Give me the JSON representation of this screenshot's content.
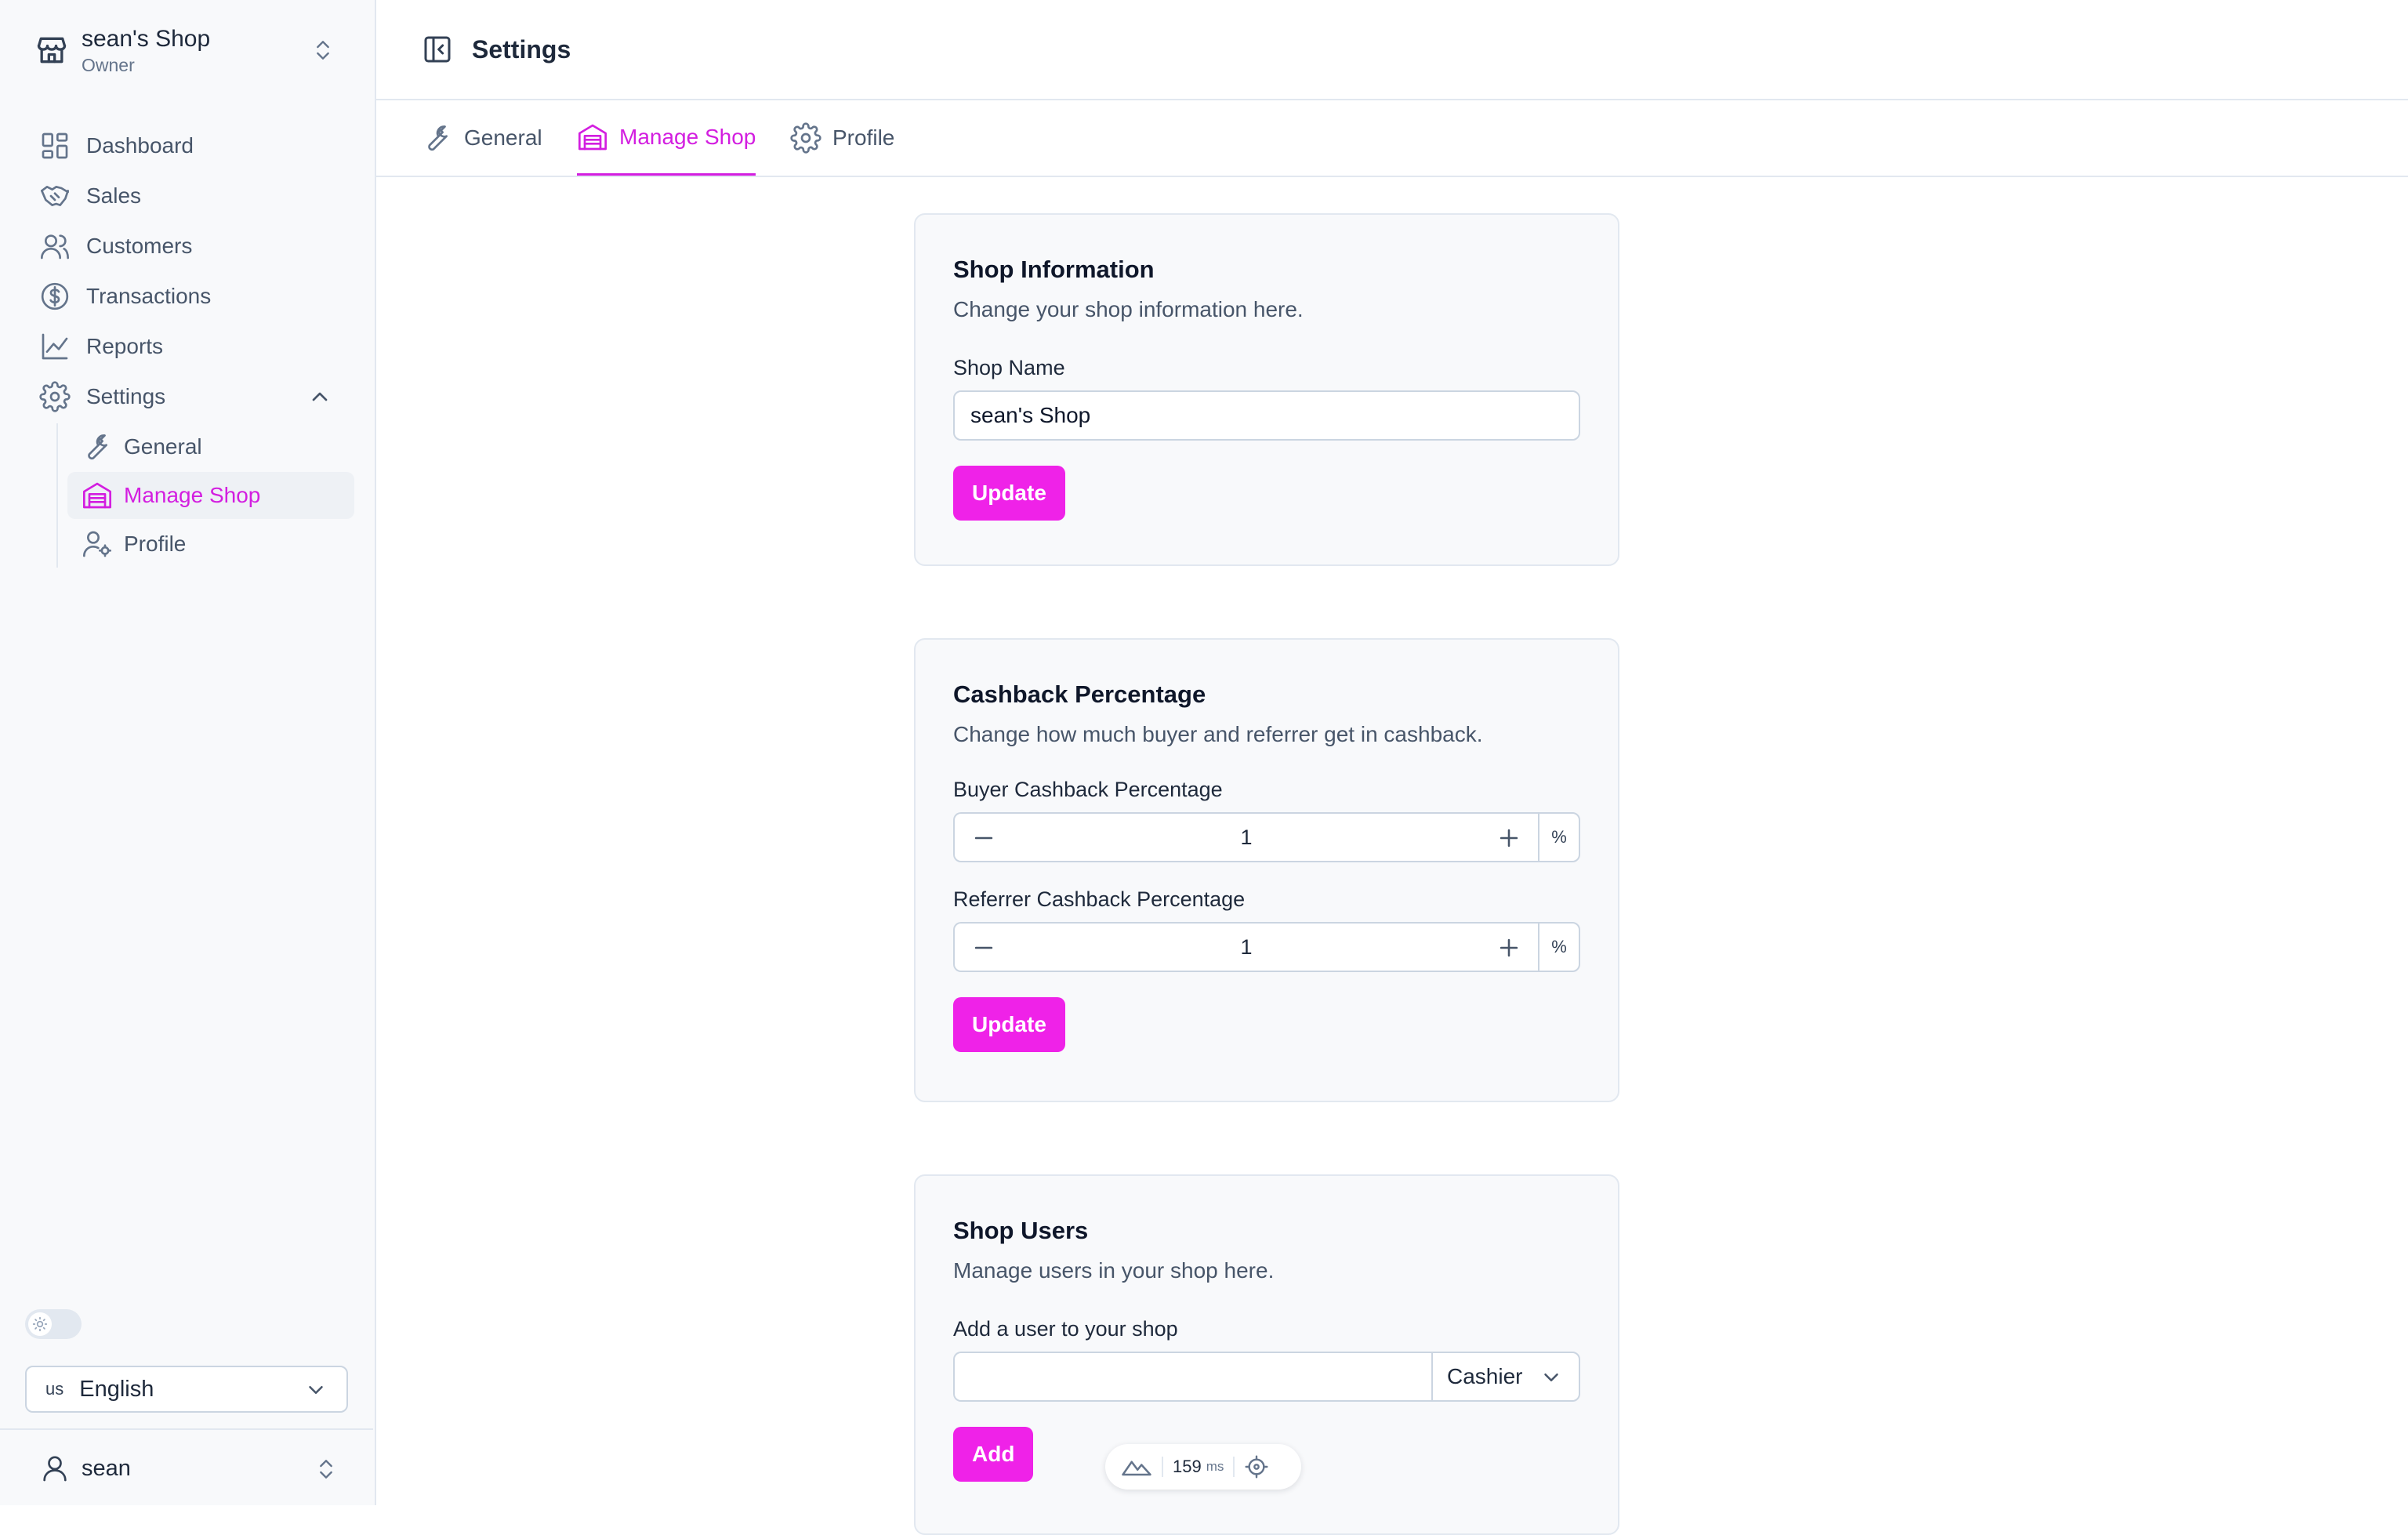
{
  "sidebar": {
    "shop_name": "sean's Shop",
    "shop_role": "Owner",
    "nav": [
      {
        "label": "Dashboard",
        "icon": "dashboard-icon"
      },
      {
        "label": "Sales",
        "icon": "handshake-icon"
      },
      {
        "label": "Customers",
        "icon": "users-icon"
      },
      {
        "label": "Transactions",
        "icon": "dollar-circle-icon"
      },
      {
        "label": "Reports",
        "icon": "line-chart-icon"
      },
      {
        "label": "Settings",
        "icon": "gear-icon"
      }
    ],
    "settings_sub": [
      {
        "label": "General",
        "icon": "wrench-icon"
      },
      {
        "label": "Manage Shop",
        "icon": "warehouse-icon",
        "active": true
      },
      {
        "label": "Profile",
        "icon": "user-cog-icon"
      }
    ],
    "language": {
      "code": "us",
      "name": "English"
    },
    "user_name": "sean"
  },
  "header": {
    "title": "Settings"
  },
  "tabs": [
    {
      "label": "General",
      "icon": "wrench-icon"
    },
    {
      "label": "Manage Shop",
      "icon": "warehouse-icon",
      "active": true
    },
    {
      "label": "Profile",
      "icon": "gear-icon"
    }
  ],
  "shop_info": {
    "title": "Shop Information",
    "description": "Change your shop information here.",
    "field_label": "Shop Name",
    "field_value": "sean's Shop",
    "button": "Update"
  },
  "cashback": {
    "title": "Cashback Percentage",
    "description": "Change how much buyer and referrer get in cashback.",
    "buyer_label": "Buyer Cashback Percentage",
    "buyer_value": "1",
    "referrer_label": "Referrer Cashback Percentage",
    "referrer_value": "1",
    "unit": "%",
    "button": "Update"
  },
  "shop_users": {
    "title": "Shop Users",
    "description": "Manage users in your shop here.",
    "field_label": "Add a user to your shop",
    "input_value": "",
    "role": "Cashier",
    "button": "Add"
  },
  "perf_widget": {
    "value": "159",
    "unit": "ms"
  },
  "colors": {
    "accent": "#ef22e8",
    "accent_text": "#d31ee0",
    "border": "#e2e8f0",
    "muted": "#475569"
  }
}
